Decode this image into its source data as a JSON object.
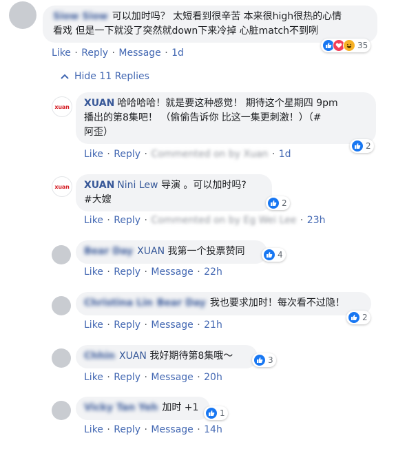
{
  "main_comment": {
    "author": "Siow Siow",
    "text_line1": "可以加时吗？ 太短看到很辛苦 本来很high很热的心情",
    "text_line2": "看戏 但是一下就没了突然就down下来冷掉 心脏match不到咧",
    "reaction_count": "35",
    "reaction_icons": [
      "like-icon",
      "love-icon",
      "haha-icon"
    ],
    "actions": [
      "Like",
      "Reply",
      "Message"
    ],
    "time": "1d"
  },
  "hide_replies": {
    "label": "Hide 11 Replies",
    "icon": "chevron-up-icon"
  },
  "replies": [
    {
      "avatar_logo": "xuan",
      "author": "XUAN",
      "text_line1": "哈哈哈哈！就是要这种感觉！ 期待这个星期四 9pm",
      "text_line2": "播出的第8集吧！ （偷偷告诉你 比这一集更刺激！）（#",
      "text_line3": "阿歪）",
      "reaction_count": "2",
      "actions": [
        "Like",
        "Reply"
      ],
      "blurred_meta": "Commented on by Xuan",
      "time": "1d"
    },
    {
      "avatar_logo": "xuan",
      "author": "XUAN",
      "mention": "Nini Lew",
      "text_line1": "导演 。可以加时吗?",
      "text_line2": "#大嫂",
      "reaction_count": "2",
      "actions": [
        "Like",
        "Reply"
      ],
      "blurred_meta": "Commented on by Eg Wei Lee",
      "time": "23h"
    },
    {
      "author_blurred": "Bear Day",
      "mention": "XUAN",
      "text": "我第一个投票赞同",
      "reaction_count": "4",
      "actions": [
        "Like",
        "Reply",
        "Message"
      ],
      "time": "22h"
    },
    {
      "author_blurred": "Christina Lin",
      "mention": "Bear Day",
      "text": "我也要求加时！每次看不过隐！",
      "reaction_count": "2",
      "actions": [
        "Like",
        "Reply",
        "Message"
      ],
      "time": "21h"
    },
    {
      "author_blurred": "Chhin",
      "mention": "XUAN",
      "text": "我好期待第8集哦～",
      "reaction_count": "3",
      "actions": [
        "Like",
        "Reply",
        "Message"
      ],
      "time": "20h"
    },
    {
      "author_blurred": "Vicky Tan Yeh",
      "text": "加时 +1",
      "reaction_count": "1",
      "actions": [
        "Like",
        "Reply",
        "Message"
      ],
      "time": "14h"
    }
  ],
  "colors": {
    "link": "#4267b2",
    "name": "#385898",
    "bubble": "#f2f3f5",
    "like": "#1877f2",
    "love": "#f33e58",
    "haha": "#f7b125"
  }
}
